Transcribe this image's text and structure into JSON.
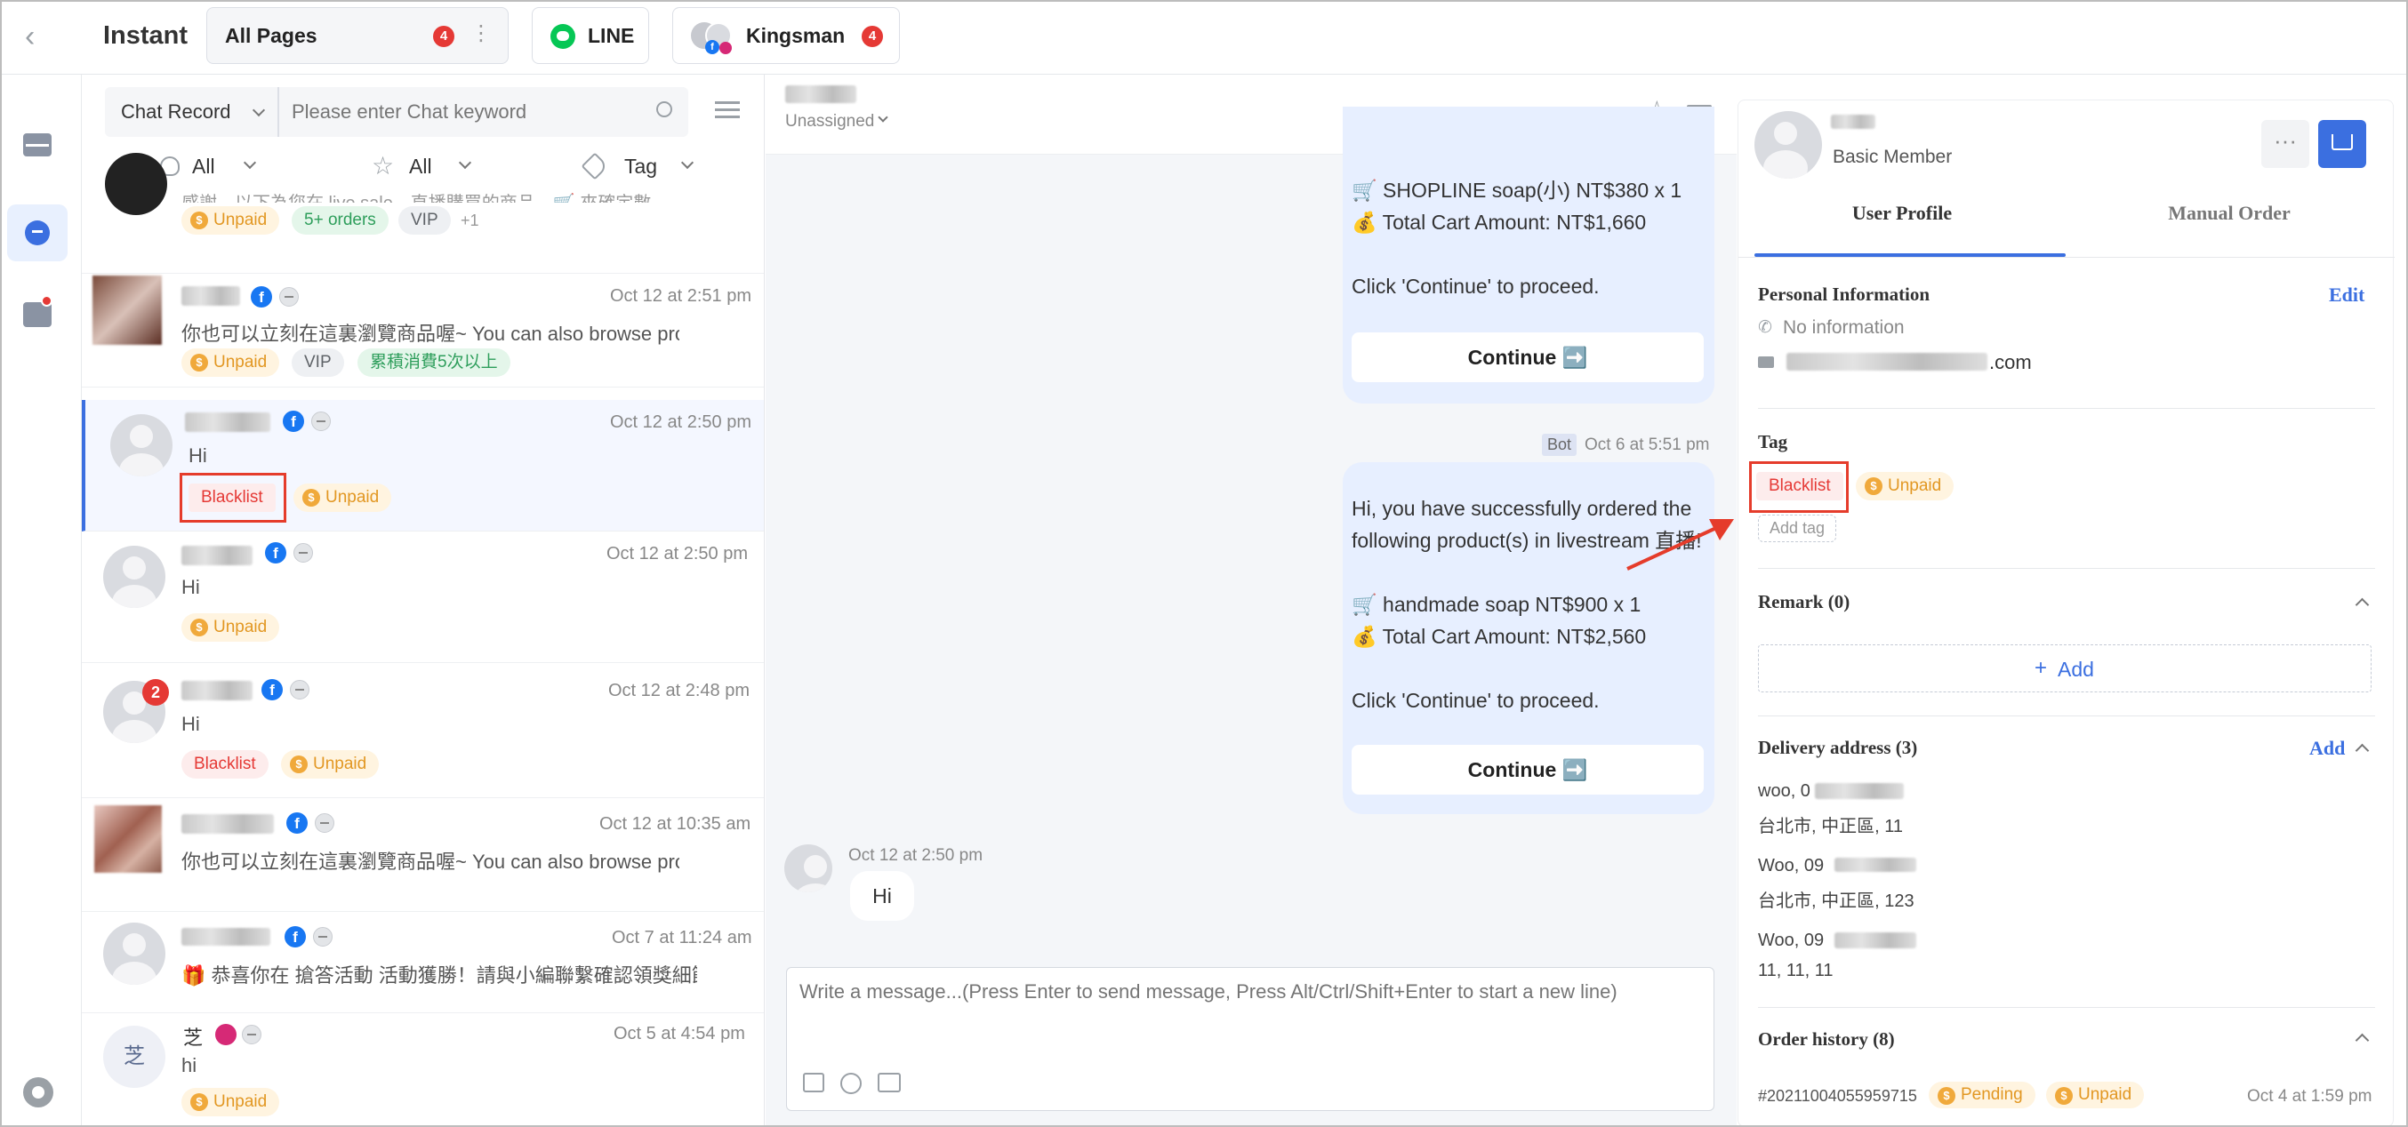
{
  "header": {
    "back_icon": "chevron-left-icon",
    "app_title": "Instant",
    "pages_label": "All Pages",
    "pages_badge": "4",
    "line_label": "LINE",
    "account_label": "Kingsman",
    "account_badge": "4"
  },
  "rail": {
    "items": [
      "inbox-icon",
      "chat-icon",
      "broadcast-icon"
    ],
    "settings": "settings-icon"
  },
  "chat_list": {
    "record_select": "Chat Record",
    "search_placeholder": "Please enter Chat keyword",
    "filter_assignee": "All",
    "filter_star": "All",
    "filter_tag": "Tag",
    "rows": [
      {
        "time": "",
        "message": "感謝，以下為您在 live sale，直播購買的商品，🛒 來確定數...",
        "tags": [
          "Unpaid",
          "5+ orders",
          "VIP",
          "+1"
        ]
      },
      {
        "time": "Oct 12 at 2:51 pm",
        "message": "你也可以立刻在這裏瀏覽商品喔~ You can also browse prod...",
        "tags": [
          "Unpaid",
          "VIP",
          "累積消費5次以上"
        ]
      },
      {
        "time": "Oct 12 at 2:50 pm",
        "message": "Hi",
        "tags": [
          "Blacklist",
          "Unpaid"
        ]
      },
      {
        "time": "Oct 12 at 2:50 pm",
        "message": "Hi",
        "tags": [
          "Unpaid"
        ]
      },
      {
        "time": "Oct 12 at 2:48 pm",
        "message": "Hi",
        "tags": [
          "Blacklist",
          "Unpaid"
        ],
        "badge": "2"
      },
      {
        "time": "Oct 12 at 10:35 am",
        "message": "你也可以立刻在這裏瀏覽商品喔~ You can also browse prod...",
        "tags": []
      },
      {
        "time": "Oct 7 at 11:24 am",
        "message": "🎁 恭喜你在 搶答活動 活動獲勝！請與小編聯繫確認領獎細節...",
        "tags": []
      },
      {
        "time": "Oct 5 at 4:54 pm",
        "message": "hi",
        "tags": [
          "Unpaid"
        ],
        "name": "芝",
        "avatar_char": "芝"
      }
    ]
  },
  "chat": {
    "assignee": "Unassigned",
    "bubble1_lines": [
      "🛒 SHOPLINE soap(小) NT$380 x 1",
      "💰 Total Cart Amount: NT$1,660",
      "",
      "Click 'Continue' to proceed."
    ],
    "continue_label": "Continue ➡️",
    "bot_label": "Bot",
    "bot_time": "Oct 6 at 5:51 pm",
    "bubble2_lines": [
      "Hi, you have successfully ordered the",
      "following product(s) in livestream 直播!",
      "",
      "🛒 handmade soap NT$900 x 1",
      "💰 Total Cart Amount: NT$2,560",
      "",
      "Click 'Continue' to proceed."
    ],
    "incoming_time": "Oct 12 at 2:50 pm",
    "incoming_text": "Hi",
    "composer_placeholder": "Write a message...(Press Enter to send message, Press Alt/Ctrl/Shift+Enter to start a new line)"
  },
  "profile": {
    "member_level": "Basic Member",
    "tab_profile": "User Profile",
    "tab_order": "Manual Order",
    "personal_title": "Personal Information",
    "edit_label": "Edit",
    "phone": "No information",
    "email_suffix": ".com",
    "tag_title": "Tag",
    "tags": [
      "Blacklist",
      "Unpaid"
    ],
    "add_tag": "Add tag",
    "remark_title": "Remark (0)",
    "remark_add": "Add",
    "delivery_title": "Delivery address (3)",
    "delivery_add": "Add",
    "addresses": [
      {
        "name": "woo, 0",
        "line": "台北市, 中正區, 11"
      },
      {
        "name": "Woo, 09",
        "line": "台北市, 中正區, 123"
      },
      {
        "name": "Woo, 09",
        "line": "11, 11, 11"
      }
    ],
    "order_title": "Order history (8)",
    "order_id": "#20211004055959715",
    "order_status": "Pending",
    "order_payment": "Unpaid",
    "order_time": "Oct 4 at 1:59 pm"
  },
  "colors": {
    "accent": "#3b6fe0",
    "annotation": "#e53c2b",
    "unpaid": "#f0a93b",
    "badge": "#e53935"
  }
}
